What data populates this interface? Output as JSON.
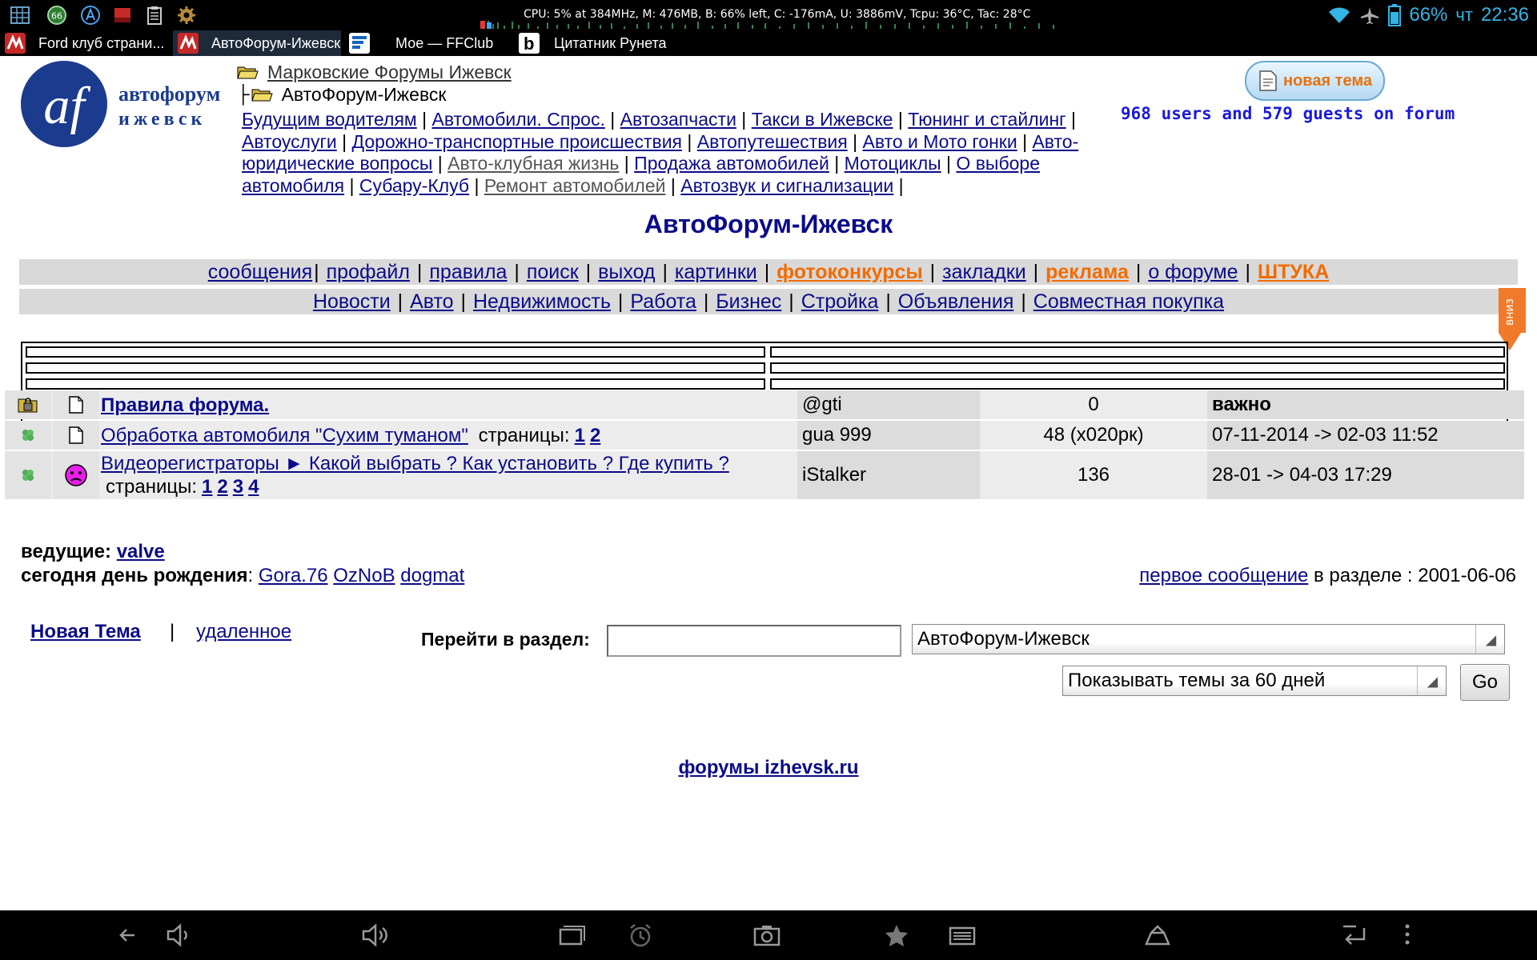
{
  "status_bar": {
    "cpu_line": "CPU: 5% at 384MHz, M: 476MB, B: 66% left, C: -176mA, U: 3886mV, Tcpu: 36°C, Tac: 28°C",
    "battery": "66%",
    "day": "чт",
    "time": "22:36",
    "notif_badge": "66",
    "icons": [
      "grid-icon",
      "badge-66-icon",
      "triangle-a-icon",
      "red-box-icon",
      "clipboard-icon",
      "gear-icon",
      "wifi-icon",
      "airplane-icon",
      "battery-icon"
    ]
  },
  "tabs": [
    {
      "title": "Ford клуб страни..."
    },
    {
      "title": "АвтоФорум-Ижевск..."
    },
    {
      "title": "Мое — FFClub"
    },
    {
      "title": "Цитатник Рунета"
    }
  ],
  "header": {
    "logo_text_top": "автофорум",
    "logo_text_bottom": "ижевск",
    "logo_mark": "af",
    "breadcrumb_parent": "Марковские Форумы Ижевск",
    "breadcrumb_current": "АвтоФорум-Ижевск",
    "new_topic_button": "новая тема",
    "online_text": "968 users and 579 guests on forum"
  },
  "sections": [
    {
      "label": "Будущим водителям",
      "style": "normal"
    },
    {
      "label": "Автомобили. Спрос.",
      "style": "normal"
    },
    {
      "label": "Автозапчасти",
      "style": "normal"
    },
    {
      "label": "Такси в Ижевске",
      "style": "normal"
    },
    {
      "label": "Тюнинг и стайлинг",
      "style": "normal"
    },
    {
      "label": "Автоуслуги",
      "style": "normal"
    },
    {
      "label": "Дорожно-транспортные происшествия",
      "style": "normal"
    },
    {
      "label": "Автопутешествия",
      "style": "normal"
    },
    {
      "label": "Авто и Мото гонки",
      "style": "normal"
    },
    {
      "label": "Авто-юридические вопросы",
      "style": "normal"
    },
    {
      "label": "Авто-клубная жизнь",
      "style": "gray"
    },
    {
      "label": "Продажа автомобилей",
      "style": "normal"
    },
    {
      "label": "Мотоциклы",
      "style": "normal"
    },
    {
      "label": "О выборе автомобиля",
      "style": "normal"
    },
    {
      "label": "Субару-Клуб",
      "style": "normal"
    },
    {
      "label": "Ремонт автомобилей",
      "style": "gray"
    },
    {
      "label": "Автозвук и сигнализации",
      "style": "normal"
    }
  ],
  "forum_title": "АвтоФорум-Ижевск",
  "nav1": [
    {
      "label": "сообщения",
      "style": "normal"
    },
    {
      "label": "профайл",
      "style": "normal"
    },
    {
      "label": "правила",
      "style": "normal"
    },
    {
      "label": "поиск",
      "style": "normal"
    },
    {
      "label": "выход",
      "style": "normal"
    },
    {
      "label": "картинки",
      "style": "normal"
    },
    {
      "label": "фотоконкурсы",
      "style": "orange"
    },
    {
      "label": "закладки",
      "style": "normal"
    },
    {
      "label": "реклама",
      "style": "orange"
    },
    {
      "label": "о форуме",
      "style": "normal"
    },
    {
      "label": "ШТУКА",
      "style": "orange"
    }
  ],
  "nav2": [
    {
      "label": "Новости"
    },
    {
      "label": "Авто"
    },
    {
      "label": "Недвижимость"
    },
    {
      "label": "Работа"
    },
    {
      "label": "Бизнес"
    },
    {
      "label": "Стройка"
    },
    {
      "label": "Объявления"
    },
    {
      "label": "Совместная покупка"
    }
  ],
  "down_tab_label": "вниз",
  "pages_label": "страницы:",
  "topics": [
    {
      "status_icon": "folder-lock-icon",
      "type_icon": "document-icon",
      "title": "Правила форума.",
      "bold": true,
      "pages": [],
      "author": "@gti",
      "replies": "0",
      "date": "важно",
      "date_bold": true
    },
    {
      "status_icon": "clover-icon",
      "type_icon": "document-icon",
      "title": "Обработка автомобиля \"Сухим туманом\"",
      "bold": false,
      "pages": [
        "1",
        "2"
      ],
      "author": "gua 999",
      "replies": "48 (x020рк)",
      "date": "07-11-2014 -> 02-03 11:52",
      "date_bold": false
    },
    {
      "status_icon": "clover-icon",
      "type_icon": "sad-face-icon",
      "title": "Видеорегистраторы ► Какой выбрать ? Как установить ? Где купить ?",
      "bold": false,
      "pages": [
        "1",
        "2",
        "3",
        "4"
      ],
      "author": "iStalker",
      "replies": "136",
      "date": "28-01 -> 04-03 17:29",
      "date_bold": false
    }
  ],
  "moderators": {
    "label": "ведущие:",
    "names": [
      "valve"
    ],
    "birthday_label": "сегодня день рождения",
    "birthday_users": [
      "Gora.76",
      "OzNoB",
      "dogmat"
    ]
  },
  "first_post": {
    "link": "первое сообщение",
    "text": "в разделе : 2001-06-06"
  },
  "actions": {
    "new_topic": "Новая Тема",
    "separator": "|",
    "deleted": "удаленное"
  },
  "goto": {
    "label": "Перейти в раздел:",
    "input_value": "",
    "section_selected": "АвтоФорум-Ижевск",
    "days_selected": "Показывать темы за 60 дней",
    "go_button": "Go"
  },
  "footer": {
    "link": "форумы izhevsk.ru"
  },
  "nav_buttons": [
    "back-icon",
    "volume-down-icon",
    "volume-up-icon",
    "recent-apps-icon",
    "alarm-icon",
    "camera-icon",
    "star-icon",
    "menu-lines-icon",
    "home-screen-icon",
    "return-icon",
    "more-dots-icon"
  ],
  "colors": {
    "link": "#0b0b8a",
    "orange": "#f26b00",
    "status_blue": "#33b5e5",
    "online_blue": "#1a1adc"
  }
}
